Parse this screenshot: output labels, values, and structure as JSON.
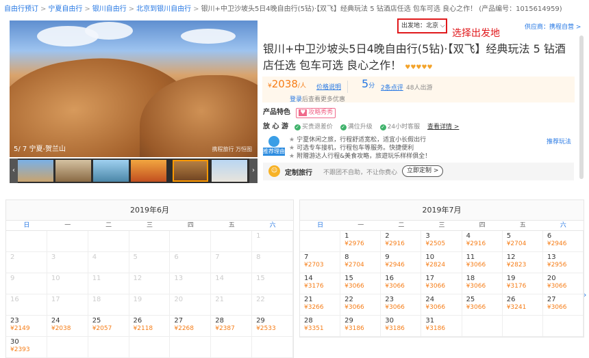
{
  "breadcrumb": {
    "items": [
      {
        "label": "自由行预订",
        "link": true
      },
      {
        "label": "宁夏自由行",
        "link": true
      },
      {
        "label": "银川自由行",
        "link": true
      },
      {
        "label": "北京到银川自由行",
        "link": true
      }
    ],
    "separator": ">",
    "current": "银川+中卫沙坡头5日4晚自由行(5钻)·【双飞】经典玩法 5 钻酒店任选 包车可选 良心之作！ (产品编号：1015614959)"
  },
  "gallery": {
    "caption": "5/ 7 宁夏-贺兰山",
    "watermark": "携程旅行 万恒图",
    "prev_arrow": "‹",
    "next_arrow": "›"
  },
  "depart": {
    "label": "出发地：北京",
    "chevron": "⌵"
  },
  "annotation": "选择出发地",
  "supplier": "供应商：携程自营 >",
  "product": {
    "title": "银川+中卫沙坡头5日4晚自由行(5钻)·【双飞】经典玩法 5 钻酒店任选 包车可选 良心之作！",
    "rating_hearts": "♥♥♥♥♥"
  },
  "price": {
    "currency": "¥",
    "amount": "2038",
    "unit": "/人",
    "explain": "价格说明",
    "login_link": "登录",
    "login_hint": "后查看更多优惠"
  },
  "score": {
    "value": "5",
    "unit": "分",
    "reviews": "2条点评",
    "tour_count": "48人出游"
  },
  "features": {
    "label": "产品特色",
    "tag_heart": "♥",
    "tag": "攻略秀秀"
  },
  "assurance": {
    "label": "放 心 游",
    "items": [
      "买贵退差价",
      "满位升级",
      "24小时客服"
    ],
    "more": "查看详情 >"
  },
  "recommend": {
    "badge": "推荐理由",
    "items": [
      "宁夏休闲之旅，行程舒适宽松，适宜小长假出行",
      "可选专车接机，行程包车等服务。快捷便利",
      "附赠游达人行程&美食攻略，旅遊玩乐样样俱全！"
    ],
    "more": "推荐玩法"
  },
  "custom": {
    "icon": "☺",
    "label": "定制旅行",
    "desc": "不跟团不自助，不让你费心",
    "button": "立即定制 >"
  },
  "calendar": {
    "weekdays": [
      "日",
      "一",
      "二",
      "三",
      "四",
      "五",
      "六"
    ],
    "months": [
      {
        "title": "2019年6月",
        "days": [
          {
            "d": ""
          },
          {
            "d": ""
          },
          {
            "d": ""
          },
          {
            "d": ""
          },
          {
            "d": ""
          },
          {
            "d": ""
          },
          {
            "d": "1"
          },
          {
            "d": "2"
          },
          {
            "d": "3"
          },
          {
            "d": "4"
          },
          {
            "d": "5"
          },
          {
            "d": "6"
          },
          {
            "d": "7"
          },
          {
            "d": "8"
          },
          {
            "d": "9"
          },
          {
            "d": "10"
          },
          {
            "d": "11"
          },
          {
            "d": "12"
          },
          {
            "d": "13"
          },
          {
            "d": "14"
          },
          {
            "d": "15"
          },
          {
            "d": "16"
          },
          {
            "d": "17"
          },
          {
            "d": "18"
          },
          {
            "d": "19"
          },
          {
            "d": "20"
          },
          {
            "d": "21"
          },
          {
            "d": "22"
          },
          {
            "d": "23",
            "p": "¥2149"
          },
          {
            "d": "24",
            "p": "¥2038"
          },
          {
            "d": "25",
            "p": "¥2057"
          },
          {
            "d": "26",
            "p": "¥2118"
          },
          {
            "d": "27",
            "p": "¥2268"
          },
          {
            "d": "28",
            "p": "¥2387"
          },
          {
            "d": "29",
            "p": "¥2533"
          },
          {
            "d": "30",
            "p": "¥2393"
          },
          {
            "d": ""
          },
          {
            "d": ""
          },
          {
            "d": ""
          },
          {
            "d": ""
          },
          {
            "d": ""
          },
          {
            "d": ""
          }
        ]
      },
      {
        "title": "2019年7月",
        "days": [
          {
            "d": ""
          },
          {
            "d": "1",
            "p": "¥2976"
          },
          {
            "d": "2",
            "p": "¥2916"
          },
          {
            "d": "3",
            "p": "¥2505"
          },
          {
            "d": "4",
            "p": "¥2916"
          },
          {
            "d": "5",
            "p": "¥2704"
          },
          {
            "d": "6",
            "p": "¥2946"
          },
          {
            "d": "7",
            "p": "¥2703"
          },
          {
            "d": "8",
            "p": "¥2704"
          },
          {
            "d": "9",
            "p": "¥2946"
          },
          {
            "d": "10",
            "p": "¥2824"
          },
          {
            "d": "11",
            "p": "¥3066"
          },
          {
            "d": "12",
            "p": "¥2823"
          },
          {
            "d": "13",
            "p": "¥2956"
          },
          {
            "d": "14",
            "p": "¥3176"
          },
          {
            "d": "15",
            "p": "¥3066"
          },
          {
            "d": "16",
            "p": "¥3066"
          },
          {
            "d": "17",
            "p": "¥3066"
          },
          {
            "d": "18",
            "p": "¥3066"
          },
          {
            "d": "19",
            "p": "¥3176"
          },
          {
            "d": "20",
            "p": "¥3066"
          },
          {
            "d": "21",
            "p": "¥3266"
          },
          {
            "d": "22",
            "p": "¥3066"
          },
          {
            "d": "23",
            "p": "¥3066"
          },
          {
            "d": "24",
            "p": "¥3066"
          },
          {
            "d": "25",
            "p": "¥3066"
          },
          {
            "d": "26",
            "p": "¥3241"
          },
          {
            "d": "27",
            "p": "¥3066"
          },
          {
            "d": "28",
            "p": "¥3351"
          },
          {
            "d": "29",
            "p": "¥3186"
          },
          {
            "d": "30",
            "p": "¥3186"
          },
          {
            "d": "31",
            "p": "¥3186"
          },
          {
            "d": ""
          },
          {
            "d": ""
          },
          {
            "d": ""
          }
        ]
      }
    ]
  },
  "colors": {
    "accent": "#2577e3",
    "price": "#f67d17",
    "highlight": "#e0181b"
  }
}
